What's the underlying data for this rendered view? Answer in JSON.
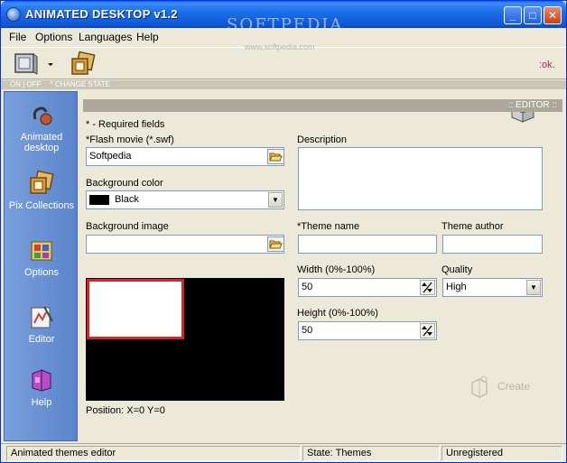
{
  "window": {
    "title": "ANIMATED DESKTOP v1.2",
    "watermark": "SOFTPEDIA",
    "watermark_url": "www.softpedia.com"
  },
  "titlebar_buttons": {
    "minimize": "_",
    "maximize": "□",
    "close": "✕"
  },
  "menu": [
    "File",
    "Options",
    "Languages",
    "Help"
  ],
  "toolbar": {
    "state_on_off": "ON | OFF",
    "state_change": "^ CHANGE STATE",
    "ok_label": ":ok."
  },
  "sidebar": {
    "items": [
      {
        "label": "Animated desktop",
        "icon": "animated-desktop-icon"
      },
      {
        "label": "Pix Collections",
        "icon": "pix-collections-icon"
      },
      {
        "label": "Options",
        "icon": "options-icon"
      },
      {
        "label": "Editor",
        "icon": "editor-icon"
      },
      {
        "label": "Help",
        "icon": "help-icon"
      }
    ]
  },
  "editor": {
    "header": ":: EDITOR ::",
    "required_note": "* - Required fields",
    "flash_movie_label": "*Flash movie (*.swf)",
    "flash_movie_value": "Softpedia",
    "background_color_label": "Background color",
    "background_color_value": "Black",
    "background_image_label": "Background image",
    "background_image_value": "",
    "description_label": "Description",
    "description_value": "",
    "theme_name_label": "*Theme name",
    "theme_name_value": "",
    "theme_author_label": "Theme author",
    "theme_author_value": "",
    "width_label": "Width (0%-100%)",
    "width_value": "50",
    "height_label": "Height (0%-100%)",
    "height_value": "50",
    "quality_label": "Quality",
    "quality_value": "High",
    "position_text": "Position: X=0  Y=0",
    "create_label": "Create"
  },
  "statusbar": {
    "left": "Animated themes editor",
    "middle": "State: Themes",
    "right": "Unregistered"
  },
  "colors": {
    "title_blue": "#0D56D6",
    "sidebar_blue": "#6E96D6",
    "preview_border": "#e02020",
    "ok_text": "#b0285a"
  }
}
